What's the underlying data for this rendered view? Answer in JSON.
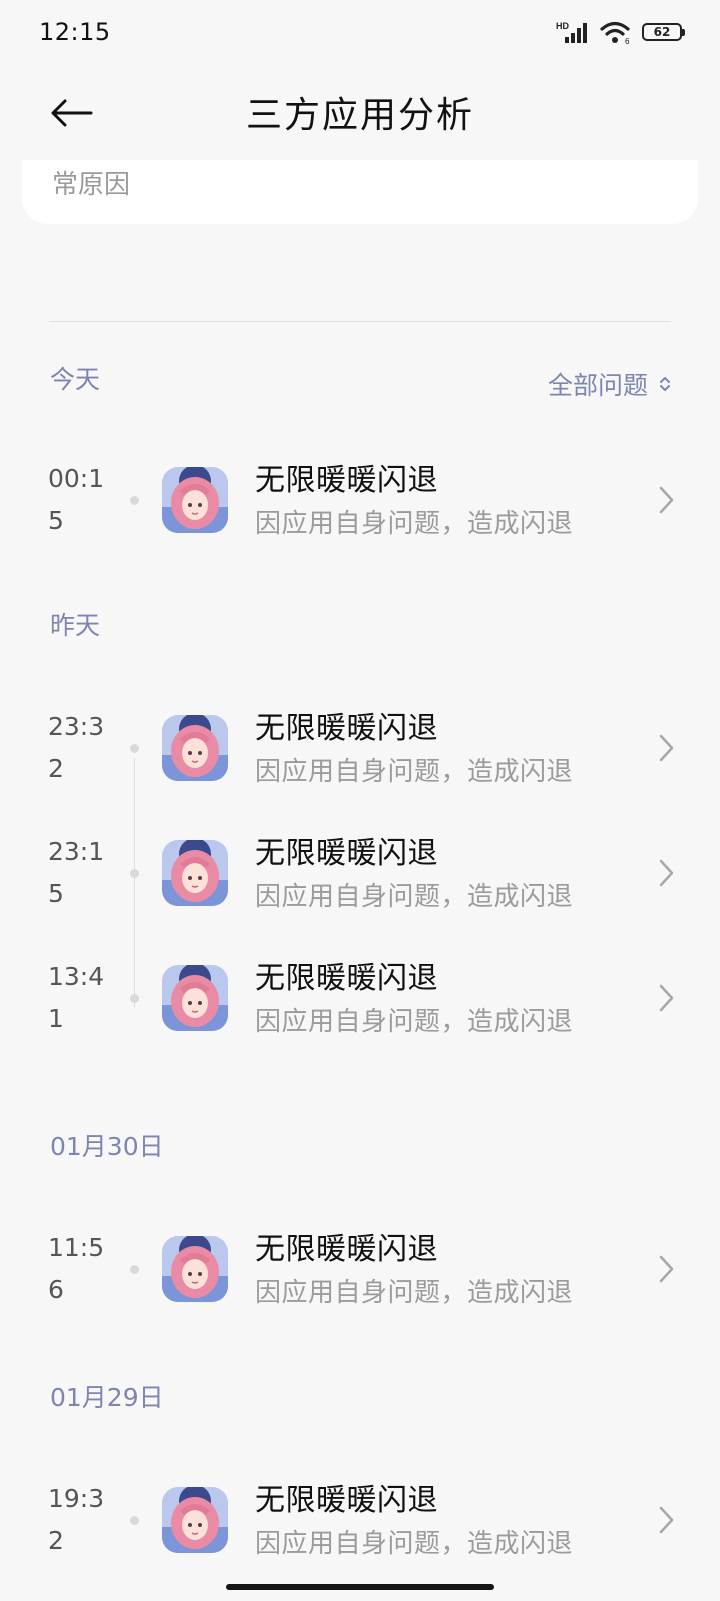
{
  "status_bar": {
    "time": "12:15",
    "network_badge": "HD",
    "battery_level": "62"
  },
  "header": {
    "title": "三方应用分析"
  },
  "top_card": {
    "text": "常原因"
  },
  "filter": {
    "label": "全部问题"
  },
  "groups": [
    {
      "label": "今天",
      "items": [
        {
          "time": "00:15",
          "title": "无限暖暖闪退",
          "subtitle": "因应用自身问题，造成闪退"
        }
      ]
    },
    {
      "label": "昨天",
      "items": [
        {
          "time": "23:32",
          "title": "无限暖暖闪退",
          "subtitle": "因应用自身问题，造成闪退"
        },
        {
          "time": "23:15",
          "title": "无限暖暖闪退",
          "subtitle": "因应用自身问题，造成闪退"
        },
        {
          "time": "13:41",
          "title": "无限暖暖闪退",
          "subtitle": "因应用自身问题，造成闪退"
        }
      ]
    },
    {
      "label": "01月30日",
      "items": [
        {
          "time": "11:56",
          "title": "无限暖暖闪退",
          "subtitle": "因应用自身问题，造成闪退"
        }
      ]
    },
    {
      "label": "01月29日",
      "items": [
        {
          "time": "19:32",
          "title": "无限暖暖闪退",
          "subtitle": "因应用自身问题，造成闪退"
        }
      ]
    }
  ],
  "icons": {
    "back": "arrow-left-icon",
    "filter": "sort-updown-icon",
    "row_action": "chevron-right-icon",
    "app": "app-icon-infinity-nikki"
  },
  "colors": {
    "background": "#f7f7f7",
    "section_header": "#7d85b0",
    "subtitle": "#9b9b9b"
  }
}
